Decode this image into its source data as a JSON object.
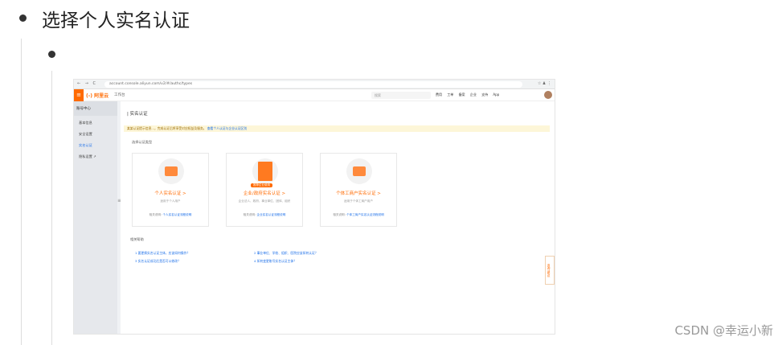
{
  "doc": {
    "heading": "选择个人实名认证",
    "watermark": "CSDN @幸运小新"
  },
  "browser": {
    "nav": "← → C",
    "url": "account.console.aliyun.com/v2/#/authc/types",
    "right": "☆ ♟ ⋮"
  },
  "console": {
    "menu_icon": "≡",
    "logo": "(-) 阿里云",
    "workbench": "工作台",
    "search_placeholder": "搜索",
    "topnav": [
      "费用",
      "工单",
      "备案",
      "企业",
      "支持",
      "App"
    ],
    "sidebar": {
      "title": "账号中心",
      "items": [
        {
          "label": "基本信息",
          "active": false
        },
        {
          "label": "安全设置",
          "active": false
        },
        {
          "label": "实名认证",
          "active": true
        },
        {
          "label": "隐私设置 ↗",
          "active": false
        }
      ]
    },
    "main": {
      "title": "| 实名认证",
      "notice": "某某认证提示信息...，完成认证后将享受对应权益及服务。",
      "notice_link": "查看个人认证与企业认证区别",
      "choose_label": "选择认证类型",
      "cards": [
        {
          "title": "个人实名认证 >",
          "subtitle": "适用于个人用户",
          "link_prefix": "相关说明:",
          "link": "个人实名认证流程说明",
          "badge": ""
        },
        {
          "title": "企业/政府实名认证 >",
          "subtitle": "企业法人、政府、事业单位、团体、组织",
          "link_prefix": "相关说明:",
          "link": "企业实名认证流程说明",
          "badge": "推荐企业使用"
        },
        {
          "title": "个体工商户实名认证 >",
          "subtitle": "适用于个体工商户用户",
          "link_prefix": "相关说明:",
          "link": "个体工商户实名认证流程说明",
          "badge": ""
        }
      ],
      "related_label": "相关帮助",
      "related_links": [
        "1 要更换实名认证主体，应该如何操作？",
        "2 事业单位、学校、组织、医院应该如何认证？",
        "3 实名认证成功后是否可以修改？",
        "4 如何变更账号实名认证主体？"
      ],
      "help_float": "咨询·建议"
    }
  }
}
